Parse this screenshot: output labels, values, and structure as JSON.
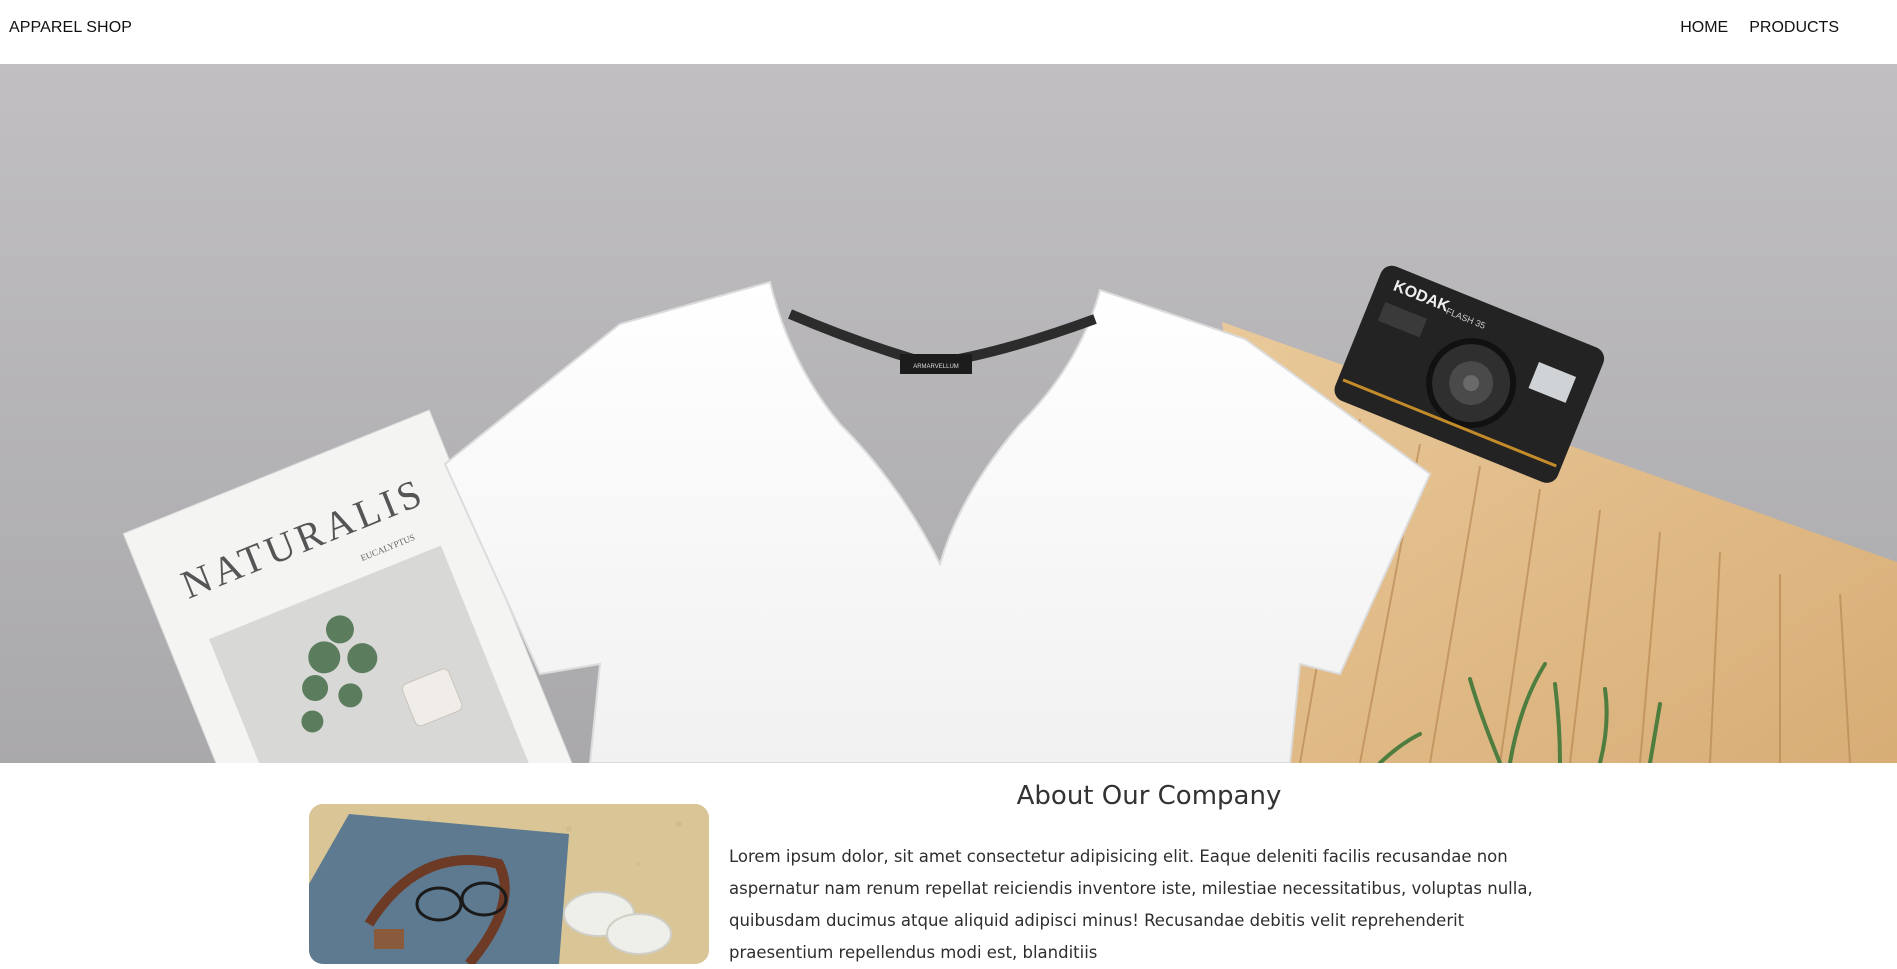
{
  "navbar": {
    "brand": "APPAREL SHOP",
    "links": [
      {
        "label": "HOME"
      },
      {
        "label": "PRODUCTS"
      }
    ]
  },
  "hero": {
    "magazine_title": "NATURALIS",
    "magazine_subtitle": "EUCALYPTUS",
    "tshirt_label": "ARMARVELLUM",
    "camera_brand": "KODAK",
    "camera_model": "FLASH 35"
  },
  "about": {
    "title": "About Our Company",
    "body": "Lorem ipsum dolor, sit amet consectetur adipisicing elit. Eaque deleniti facilis recusandae non aspernatur nam renum repellat reiciendis inventore iste, milestiae necessitatibus, voluptas nulla, quibusdam ducimus atque aliquid adipisci minus! Recusandae debitis velit reprehenderit praesentium repellendus modi est, blanditiis"
  },
  "colors": {
    "background": "#ffffff",
    "text": "#111111",
    "hero_bg": "#b3b2b5"
  }
}
